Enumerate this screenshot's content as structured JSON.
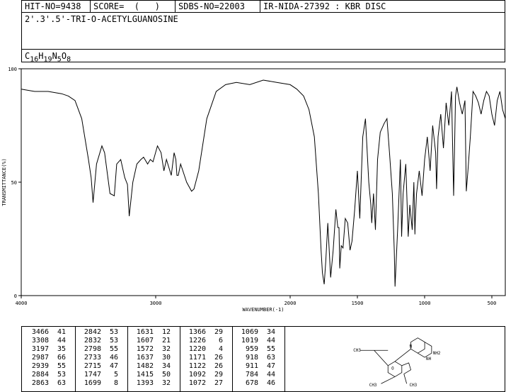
{
  "header": {
    "hit_no": "HIT-NO=9438",
    "score": "SCORE=  (   )",
    "sdbs_no": "SDBS-NO=22003",
    "ir_info": "IR-NIDA-27392 : KBR DISC",
    "compound_name": "2'.3'.5'-TRI-O-ACETYLGUANOSINE",
    "formula_c": "C",
    "formula_c_n": "16",
    "formula_h": "H",
    "formula_h_n": "19",
    "formula_n": "N",
    "formula_n_n": "5",
    "formula_o": "O",
    "formula_o_n": "8"
  },
  "chart_data": {
    "type": "line",
    "xlabel": "WAVENUMBER(-1)",
    "ylabel": "TRANSMITTANCE(%)",
    "xlim": [
      4000,
      400
    ],
    "ylim": [
      0,
      100
    ],
    "x_ticks": [
      4000,
      3000,
      2000,
      1500,
      1000,
      500
    ],
    "y_ticks": [
      0,
      50,
      100
    ],
    "grid": false,
    "series": [
      {
        "x": [
          4000,
          3900,
          3800,
          3700,
          3650,
          3600,
          3550,
          3500,
          3480,
          3466,
          3440,
          3400,
          3380,
          3340,
          3308,
          3290,
          3260,
          3230,
          3210,
          3197,
          3170,
          3140,
          3110,
          3090,
          3060,
          3040,
          3020,
          2987,
          2960,
          2939,
          2920,
          2884,
          2863,
          2850,
          2842,
          2832,
          2815,
          2798,
          2770,
          2733,
          2715,
          2680,
          2620,
          2550,
          2480,
          2400,
          2300,
          2200,
          2100,
          2000,
          1950,
          1900,
          1860,
          1820,
          1790,
          1770,
          1760,
          1747,
          1735,
          1720,
          1699,
          1680,
          1660,
          1645,
          1637,
          1631,
          1620,
          1607,
          1590,
          1572,
          1555,
          1540,
          1520,
          1500,
          1482,
          1460,
          1440,
          1415,
          1400,
          1393,
          1380,
          1366,
          1350,
          1330,
          1300,
          1280,
          1260,
          1240,
          1226,
          1220,
          1200,
          1180,
          1171,
          1160,
          1140,
          1122,
          1110,
          1092,
          1080,
          1072,
          1069,
          1060,
          1040,
          1019,
          1000,
          980,
          959,
          940,
          918,
          911,
          900,
          880,
          860,
          840,
          820,
          800,
          784,
          770,
          760,
          740,
          720,
          700,
          690,
          678,
          660,
          640,
          620,
          600,
          580,
          560,
          540,
          520,
          500,
          480,
          460,
          440,
          420,
          400
        ],
        "y": [
          91,
          90,
          90,
          89,
          88,
          86,
          78,
          60,
          52,
          41,
          58,
          66,
          63,
          45,
          44,
          58,
          60,
          52,
          49,
          35,
          50,
          58,
          60,
          61,
          58,
          60,
          59,
          66,
          63,
          55,
          60,
          53,
          63,
          60,
          53,
          53,
          58,
          55,
          50,
          46,
          47,
          55,
          78,
          90,
          93,
          94,
          93,
          95,
          94,
          93,
          91,
          88,
          82,
          70,
          45,
          20,
          10,
          5,
          15,
          32,
          8,
          20,
          38,
          30,
          30,
          12,
          22,
          21,
          34,
          32,
          20,
          24,
          38,
          55,
          34,
          70,
          78,
          50,
          40,
          32,
          45,
          29,
          60,
          72,
          76,
          78,
          62,
          45,
          20,
          4,
          30,
          60,
          26,
          45,
          58,
          26,
          40,
          29,
          50,
          27,
          34,
          45,
          55,
          44,
          60,
          70,
          55,
          75,
          63,
          47,
          70,
          80,
          65,
          85,
          75,
          90,
          44,
          88,
          92,
          85,
          80,
          86,
          46,
          55,
          70,
          90,
          88,
          85,
          80,
          86,
          90,
          88,
          80,
          75,
          86,
          90,
          82,
          78
        ]
      }
    ]
  },
  "peak_table": {
    "columns": [
      [
        [
          "3466",
          "41"
        ],
        [
          "3308",
          "44"
        ],
        [
          "3197",
          "35"
        ],
        [
          "2987",
          "66"
        ],
        [
          "2939",
          "55"
        ],
        [
          "2884",
          "53"
        ],
        [
          "2863",
          "63"
        ]
      ],
      [
        [
          "2842",
          "53"
        ],
        [
          "2832",
          "53"
        ],
        [
          "2798",
          "55"
        ],
        [
          "2733",
          "46"
        ],
        [
          "2715",
          "47"
        ],
        [
          "1747",
          "5"
        ],
        [
          "1699",
          "8"
        ]
      ],
      [
        [
          "1631",
          "12"
        ],
        [
          "1607",
          "21"
        ],
        [
          "1572",
          "32"
        ],
        [
          "1637",
          "30"
        ],
        [
          "1482",
          "34"
        ],
        [
          "1415",
          "50"
        ],
        [
          "1393",
          "32"
        ]
      ],
      [
        [
          "1366",
          "29"
        ],
        [
          "1226",
          "6"
        ],
        [
          "1220",
          "4"
        ],
        [
          "1171",
          "26"
        ],
        [
          "1122",
          "26"
        ],
        [
          "1092",
          "29"
        ],
        [
          "1072",
          "27"
        ]
      ],
      [
        [
          "1069",
          "34"
        ],
        [
          "1019",
          "44"
        ],
        [
          "959",
          "55"
        ],
        [
          "918",
          "63"
        ],
        [
          "911",
          "47"
        ],
        [
          "784",
          "44"
        ],
        [
          "678",
          "46"
        ]
      ]
    ]
  },
  "structure": {
    "substituents": [
      "CH3",
      "CH3",
      "CH3",
      "NH2",
      "NH",
      "N",
      "O"
    ]
  }
}
